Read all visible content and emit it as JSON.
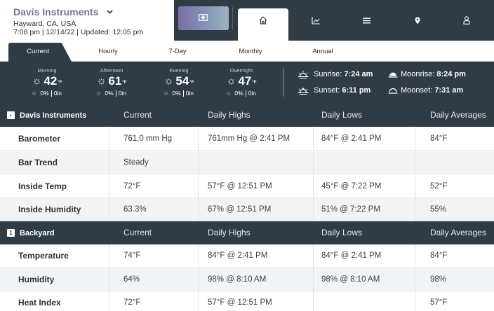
{
  "station": {
    "name": "Davis Instruments",
    "location": "Hayward, CA, USA",
    "time_line": "7:08 pm | 12/14/22 | Updated: 12:05 pm"
  },
  "icons": {
    "dropdown": "chevron-down-icon",
    "console": "console-icon",
    "home": "home-icon",
    "chart": "chart-icon",
    "list": "list-icon",
    "map": "location-pin-icon",
    "user": "user-icon"
  },
  "tabs": [
    "Current",
    "Hourly",
    "7-Day",
    "Monthly",
    "Annual"
  ],
  "forecast": [
    {
      "period": "Morning",
      "temp": "42",
      "unit": "°F",
      "precip": "0%",
      "amount": "0in"
    },
    {
      "period": "Afternoon",
      "temp": "61",
      "unit": "°F",
      "precip": "0%",
      "amount": "0in"
    },
    {
      "period": "Evening",
      "temp": "54",
      "unit": "°F",
      "precip": "0%",
      "amount": "0in"
    },
    {
      "period": "Overnight",
      "temp": "47",
      "unit": "°F",
      "precip": "0%",
      "amount": "0in"
    }
  ],
  "astro": {
    "sunrise_label": "Sunrise:",
    "sunrise": "7:24 am",
    "sunset_label": "Sunset:",
    "sunset": "6:11 pm",
    "moonrise_label": "Moonrise:",
    "moonrise": "8:24 pm",
    "moonset_label": "Moonset:",
    "moonset": "7:31 am"
  },
  "sections": [
    {
      "badge": "‹",
      "title": "Davis Instruments",
      "columns": [
        "Current",
        "Daily Highs",
        "Daily Lows",
        "Daily Averages"
      ],
      "rows": [
        {
          "label": "Barometer",
          "current": "761,0 mm Hg",
          "high": "761mm Hg @ 2:41 PM",
          "low": "84°F @ 2:41 PM",
          "avg": "84°F"
        },
        {
          "label": "Bar Trend",
          "current": "Steady",
          "high": "",
          "low": "",
          "avg": ""
        },
        {
          "label": "Inside Temp",
          "current": "72°F",
          "high": "57°F @ 12:51 PM",
          "low": "45°F @ 7:22 PM",
          "avg": "52°F"
        },
        {
          "label": "Inside Humidity",
          "current": "63.3%",
          "high": "67% @ 12:51 PM",
          "low": "51% @ 7:22 PM",
          "avg": "55%"
        }
      ]
    },
    {
      "badge": "1",
      "title": "Backyard",
      "columns": [
        "Current",
        "Daily Highs",
        "Daily Lows",
        "Daily Averages"
      ],
      "rows": [
        {
          "label": "Temperature",
          "current": "74°F",
          "high": "84°F @ 2:41 PM",
          "low": "84°F @ 2:41 PM",
          "avg": "84°F"
        },
        {
          "label": "Humidity",
          "current": "64%",
          "high": "98% @ 8:10 AM",
          "low": "98% @ 8:10 AM",
          "avg": "98%"
        },
        {
          "label": "Heat Index",
          "current": "72°F",
          "high": "57°F @ 12:51 PM",
          "low": "",
          "avg": "57°F"
        }
      ]
    }
  ]
}
